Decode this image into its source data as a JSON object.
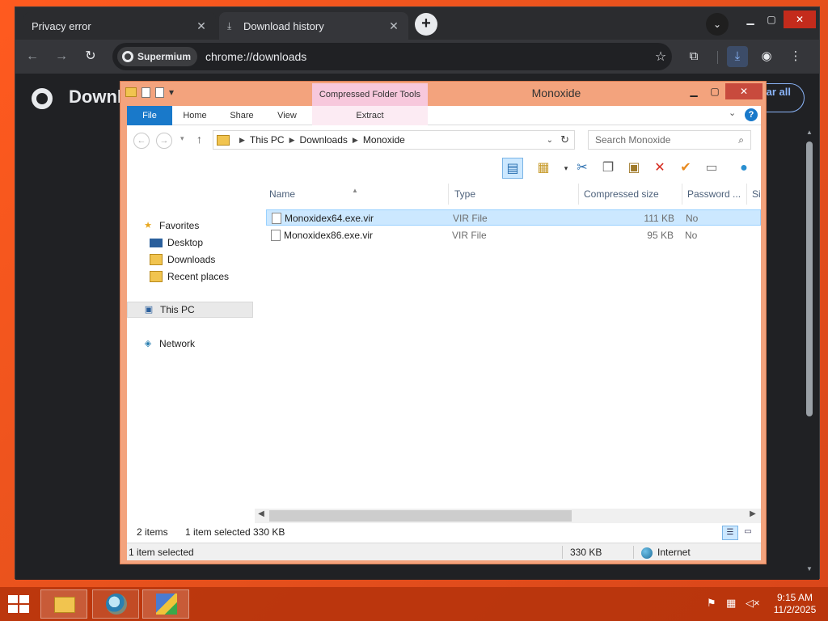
{
  "browser": {
    "tabs": [
      {
        "label": "Privacy error"
      },
      {
        "label": "Download history"
      }
    ],
    "omnibox": {
      "chip_label": "Supermium",
      "url": "chrome://downloads"
    },
    "page": {
      "title": "Downl",
      "clear_all_label": "Clear all"
    }
  },
  "explorer": {
    "title": "Monoxide",
    "contextual_tab_header": "Compressed Folder Tools",
    "ribbon_tabs": {
      "file": "File",
      "home": "Home",
      "share": "Share",
      "view": "View",
      "extract": "Extract"
    },
    "breadcrumb": [
      "This PC",
      "Downloads",
      "Monoxide"
    ],
    "search_placeholder": "Search Monoxide",
    "nav_pane": {
      "favorites": "Favorites",
      "desktop": "Desktop",
      "downloads": "Downloads",
      "recent_places": "Recent places",
      "this_pc": "This PC",
      "network": "Network"
    },
    "columns": {
      "name": "Name",
      "type": "Type",
      "compressed_size": "Compressed size",
      "password": "Password ...",
      "size": "Si"
    },
    "files": [
      {
        "name": "Monoxidex64.exe.vir",
        "type": "VIR File",
        "compressed_size": "111 KB",
        "password": "No"
      },
      {
        "name": "Monoxidex86.exe.vir",
        "type": "VIR File",
        "compressed_size": "95 KB",
        "password": "No"
      }
    ],
    "status": {
      "item_count": "2 items",
      "selection": "1 item selected",
      "selection_size": "330 KB"
    },
    "detail_bar": {
      "selection": "1 item selected",
      "size": "330 KB",
      "zone": "Internet"
    }
  },
  "taskbar": {
    "clock": {
      "time": "9:15 AM",
      "date": "11/2/2025"
    }
  },
  "colors": {
    "desktop": "#e8521d",
    "explorer_frame": "#f3a37d",
    "ribbon_file_tab": "#1979ca",
    "contextual_tab": "#f7c8dc",
    "selection": "#cce8ff"
  }
}
